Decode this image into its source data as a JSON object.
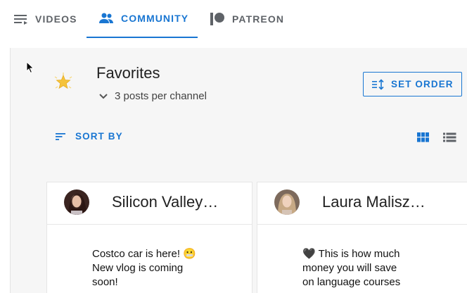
{
  "tabs": [
    {
      "label": "VIDEOS",
      "icon": "playlist-icon",
      "active": false
    },
    {
      "label": "COMMUNITY",
      "icon": "people-icon",
      "active": true
    },
    {
      "label": "PATREON",
      "icon": "patreon-icon",
      "active": false
    }
  ],
  "favorites": {
    "icon": "star-icon",
    "title": "Favorites",
    "posts_per_channel": "3 posts per channel"
  },
  "toolbar": {
    "set_order_label": "SET ORDER",
    "sort_by_label": "SORT BY"
  },
  "cards": [
    {
      "channel": "Silicon Valley…",
      "lines": [
        "Costco car is here! 😬",
        "New vlog is coming",
        "soon!"
      ]
    },
    {
      "channel": "Laura Malisz…",
      "lines": [
        "🖤 This is how much",
        "money you will save",
        "on language courses"
      ]
    }
  ],
  "colors": {
    "accent": "#1976d2",
    "panel_bg": "#f6f6f6",
    "text": "#212121"
  }
}
